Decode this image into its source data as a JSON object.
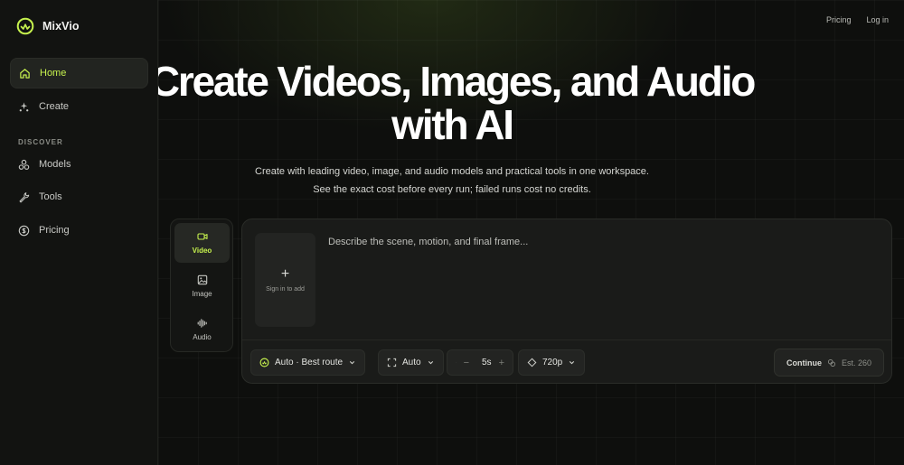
{
  "brand": {
    "name": "MixVio",
    "accent": "#c6f24e"
  },
  "sidebar": {
    "items": [
      {
        "label": "Home",
        "icon": "home-icon",
        "active": true
      },
      {
        "label": "Create",
        "icon": "sparkle-icon"
      }
    ],
    "section": "DISCOVER",
    "discover_items": [
      {
        "label": "Models",
        "icon": "cubes-icon"
      },
      {
        "label": "Tools",
        "icon": "wrench-icon"
      },
      {
        "label": "Pricing",
        "icon": "dollar-circle-icon"
      }
    ]
  },
  "topnav": {
    "pricing": "Pricing",
    "login": "Log in"
  },
  "hero": {
    "title_line1": "Create Videos, Images, and Audio",
    "title_line2": "with AI",
    "subtitle_line1": "Create with leading video, image, and audio models and practical tools in one workspace.",
    "subtitle_line2": "See the exact cost before every run; failed runs cost no credits."
  },
  "modes": [
    {
      "label": "Video",
      "icon": "video-camera-icon",
      "active": true
    },
    {
      "label": "Image",
      "icon": "image-icon"
    },
    {
      "label": "Audio",
      "icon": "waveform-icon"
    }
  ],
  "composer": {
    "upload_label": "Sign in to add",
    "upload_symbol": "+",
    "prompt_placeholder": "Describe the scene, motion, and final frame...",
    "model_select": "Auto · Best route",
    "aspect_select": "Auto",
    "duration": {
      "minus": "−",
      "value": "5s",
      "plus": "+"
    },
    "resolution_select": "720p",
    "continue_label": "Continue",
    "estimate": "Est. 260"
  }
}
